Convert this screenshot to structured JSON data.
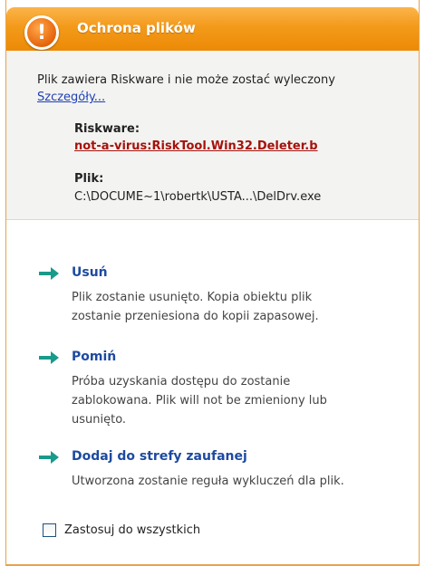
{
  "window": {
    "title": "Ochrona plików"
  },
  "info": {
    "message": "Plik zawiera Riskware i nie może zostać wyleczony",
    "details_link": "Szczegóły...",
    "riskware_label": "Riskware:",
    "riskware_name": "not-a-virus:RiskTool.Win32.Deleter.b",
    "file_label": "Plik:",
    "file_path": "C:\\DOCUME~1\\robertk\\USTA...\\DelDrv.exe"
  },
  "actions": [
    {
      "title": "Usuń",
      "desc_lines": [
        "Plik zostanie usunięto. Kopia obiektu plik",
        "zostanie przeniesiona do kopii zapasowej."
      ]
    },
    {
      "title": "Pomiń",
      "desc_lines": [
        "Próba uzyskania dostępu do  zostanie",
        "zablokowana. Plik will not be zmieniony lub",
        "usunięto."
      ]
    },
    {
      "title": "Dodaj do strefy zaufanej",
      "desc_lines": [
        "Utworzona zostanie reguła wykluczeń dla plik."
      ]
    }
  ],
  "apply_all": {
    "label": "Zastosuj do wszystkich",
    "checked": false
  },
  "colors": {
    "title_bar": "#f39a1a",
    "link": "#1f3fb5",
    "threat_name": "#a5120c",
    "action_title": "#1d4aa0",
    "arrow": "#1a9a8a"
  },
  "icons": {
    "warning": "exclamation-circle",
    "action": "arrow-right"
  }
}
